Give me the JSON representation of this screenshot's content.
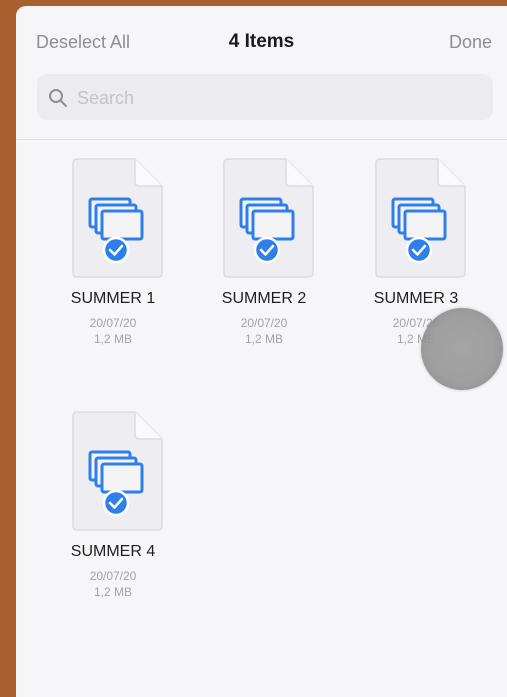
{
  "nav": {
    "deselect_label": "Deselect All",
    "title": "4 Items",
    "done_label": "Done"
  },
  "search": {
    "placeholder": "Search",
    "icon": "magnifier-icon"
  },
  "files": [
    {
      "name": "SUMMER 1",
      "date": "20/07/20",
      "size": "1,2 MB",
      "selected": true
    },
    {
      "name": "SUMMER 2",
      "date": "20/07/20",
      "size": "1,2 MB",
      "selected": true
    },
    {
      "name": "SUMMER 3",
      "date": "20/07/20",
      "size": "1,2 MB",
      "selected": true
    },
    {
      "name": "SUMMER 4",
      "date": "20/07/20",
      "size": "1,2 MB",
      "selected": true
    }
  ],
  "colors": {
    "accent": "#2f7fea",
    "background": "#a8602f",
    "sheet": "#f6f6f8"
  }
}
